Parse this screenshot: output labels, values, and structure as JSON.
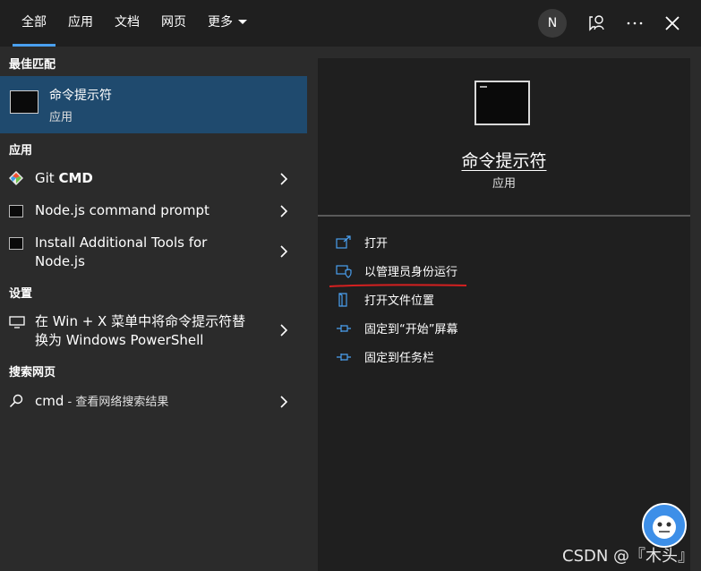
{
  "tabs": [
    {
      "label": "全部",
      "active": true
    },
    {
      "label": "应用"
    },
    {
      "label": "文档"
    },
    {
      "label": "网页"
    },
    {
      "label": "更多"
    }
  ],
  "account_initial": "N",
  "left": {
    "best_match_header": "最佳匹配",
    "best_match": {
      "title": "命令提示符",
      "subtitle": "应用"
    },
    "apps_header": "应用",
    "apps": [
      {
        "label_pre": "Git ",
        "label_bold": "CMD",
        "icon": "git-icon"
      },
      {
        "label": "Node.js command prompt",
        "icon": "console-icon"
      },
      {
        "label": "Install Additional Tools for Node.js",
        "icon": "console-icon"
      }
    ],
    "settings_header": "设置",
    "settings": [
      {
        "label": "在 Win + X 菜单中将命令提示符替换为 Windows PowerShell",
        "icon": "display-icon"
      }
    ],
    "web_header": "搜索网页",
    "web": [
      {
        "query": "cmd",
        "suffix": " - 查看网络搜索结果",
        "icon": "search-icon"
      }
    ]
  },
  "right": {
    "title": "命令提示符",
    "subtitle": "应用",
    "actions": [
      {
        "label": "打开",
        "icon": "open-icon"
      },
      {
        "label": "以管理员身份运行",
        "icon": "shield-icon",
        "highlighted": true
      },
      {
        "label": "打开文件位置",
        "icon": "file-location-icon"
      },
      {
        "label": "固定到“开始”屏幕",
        "icon": "pin-icon"
      },
      {
        "label": "固定到任务栏",
        "icon": "pin-icon"
      }
    ]
  },
  "watermark": "CSDN @『木头』",
  "colors": {
    "accent": "#4aa0f0",
    "selected": "#1f4a6e",
    "annotation": "#d42020"
  }
}
